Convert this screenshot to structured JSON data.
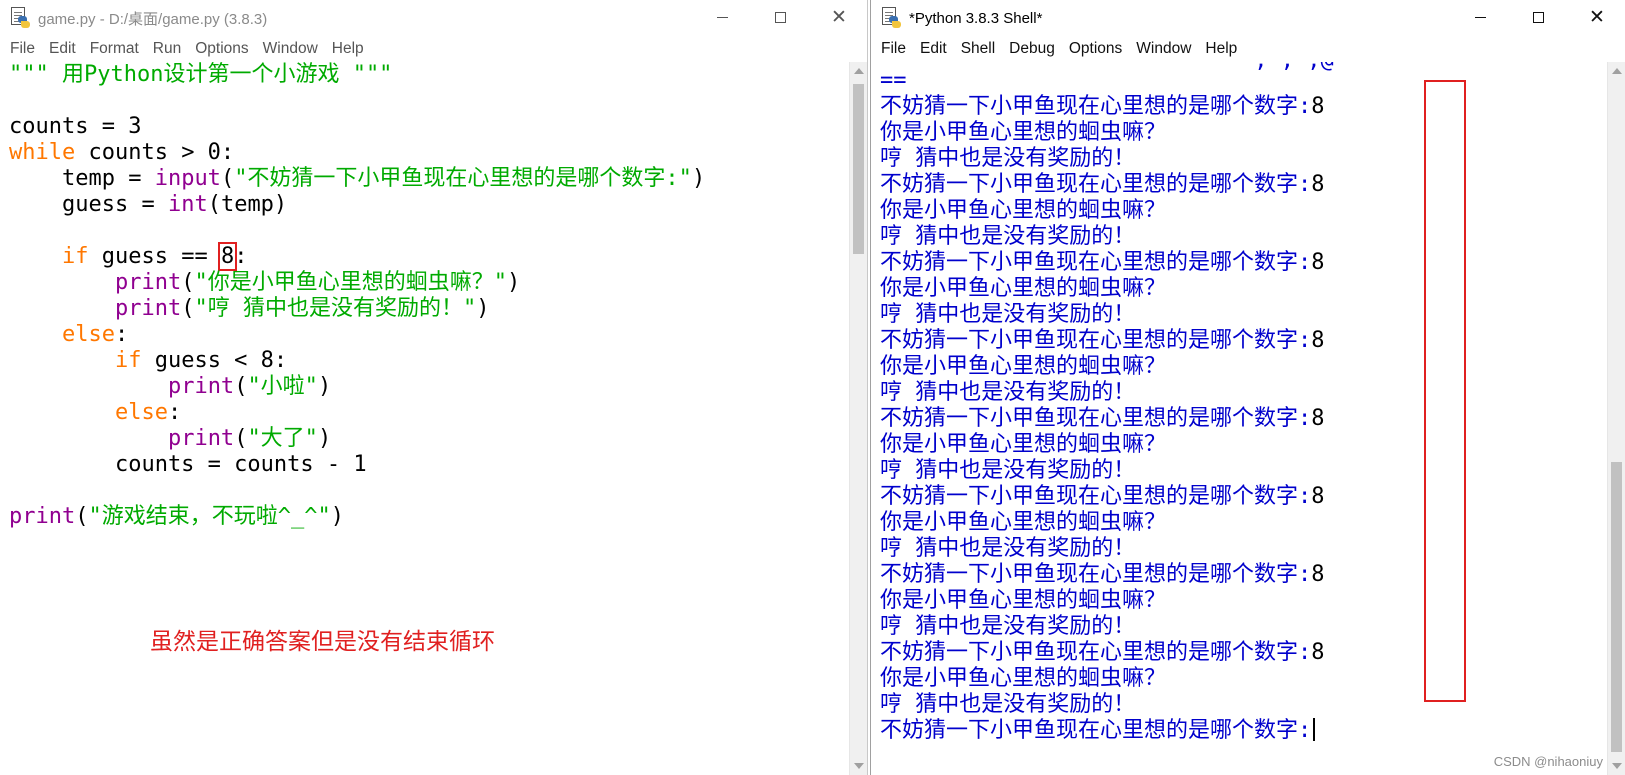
{
  "editor": {
    "title": "game.py - D:/桌面/game.py (3.8.3)",
    "menu": [
      "File",
      "Edit",
      "Format",
      "Run",
      "Options",
      "Window",
      "Help"
    ],
    "code": {
      "l1": "\"\"\" 用Python设计第一个小游戏 \"\"\"",
      "l3": "counts = 3",
      "l4_kw": "while",
      "l4_rest": " counts > 0:",
      "l5_a": "    temp = ",
      "l5_fn": "input",
      "l5_b": "(",
      "l5_str": "\"不妨猜一下小甲鱼现在心里想的是哪个数字:\"",
      "l5_c": ")",
      "l6_a": "    guess = ",
      "l6_fn": "int",
      "l6_b": "(temp)",
      "l8_indent": "    ",
      "l8_kw": "if",
      "l8_a": " guess == ",
      "l8_num": "8",
      "l8_b": ":",
      "l9_indent": "        ",
      "l9_fn": "print",
      "l9_a": "(",
      "l9_str": "\"你是小甲鱼心里想的蛔虫嘛？\"",
      "l9_b": ")",
      "l10_indent": "        ",
      "l10_fn": "print",
      "l10_a": "(",
      "l10_str": "\"哼 猜中也是没有奖励的！\"",
      "l10_b": ")",
      "l11_indent": "    ",
      "l11_kw": "else",
      "l11_a": ":",
      "l12_indent": "        ",
      "l12_kw": "if",
      "l12_a": " guess < 8:",
      "l13_indent": "            ",
      "l13_fn": "print",
      "l13_a": "(",
      "l13_str": "\"小啦\"",
      "l13_b": ")",
      "l14_indent": "        ",
      "l14_kw": "else",
      "l14_a": ":",
      "l15_indent": "            ",
      "l15_fn": "print",
      "l15_a": "(",
      "l15_str": "\"大了\"",
      "l15_b": ")",
      "l16": "        counts = counts - 1",
      "l18_fn": "print",
      "l18_a": "(",
      "l18_str": "\"游戏结束，不玩啦^_^\"",
      "l18_b": ")"
    },
    "annotation": "虽然是正确答案但是没有结束循环"
  },
  "shell": {
    "title": "*Python 3.8.3 Shell*",
    "menu": [
      "File",
      "Edit",
      "Shell",
      "Debug",
      "Options",
      "Window",
      "Help"
    ],
    "clipped_top": "',',',@ '",
    "separator": "==",
    "prompt": "不妨猜一下小甲鱼现在心里想的是哪个数字:",
    "input_value": "8",
    "reply1": "你是小甲鱼心里想的蛔虫嘛？",
    "reply2": "哼 猜中也是没有奖励的！",
    "watermark": "CSDN @nihaoniuy"
  },
  "colors": {
    "keyword": "#ff7700",
    "builtin": "#900090",
    "string": "#00aa00",
    "shell_output": "#0000cc",
    "annotation_red": "#e02020"
  },
  "icons": {
    "app": "python-idle-file-icon",
    "minimize": "minimize-icon",
    "maximize": "maximize-icon",
    "close": "close-icon"
  }
}
